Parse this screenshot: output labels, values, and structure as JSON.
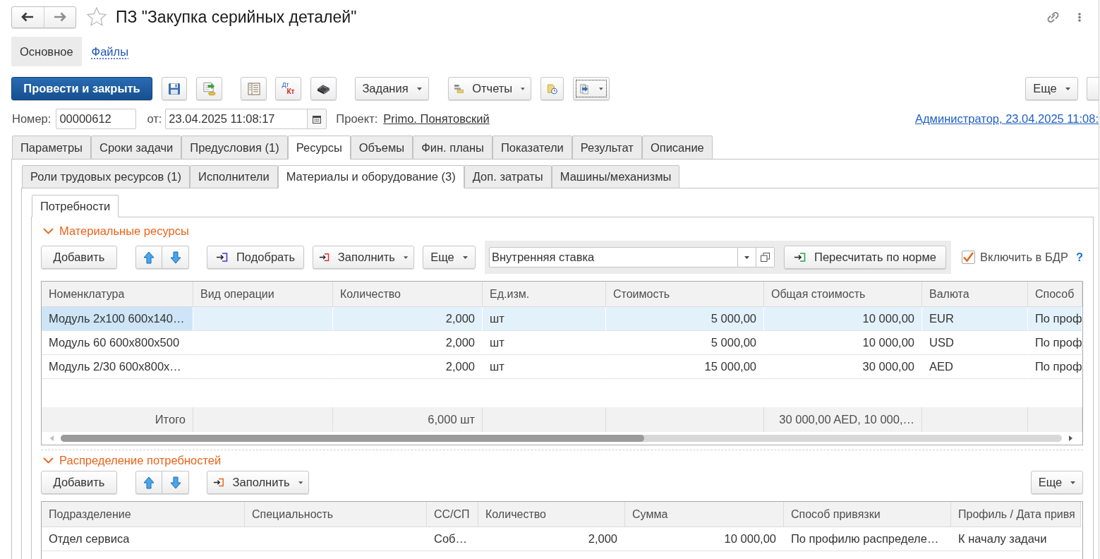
{
  "header": {
    "title": "ПЗ \"Закупка серийных деталей\"",
    "favorite": false
  },
  "sections": [
    {
      "label": "Основное",
      "selected": true
    },
    {
      "label": "Файлы",
      "selected": false
    }
  ],
  "toolbar": {
    "primary_button": "Провести и закрыть",
    "dt_kt_icon": {
      "top": "Дт",
      "bottom": "Кт"
    },
    "tasks_button": "Задания",
    "reports_button": "Отчеты",
    "transfer_button": {
      "focused": true
    },
    "more_button": "Еще"
  },
  "fields": {
    "number_label": "Номер:",
    "number": "00000612",
    "date_label": "от:",
    "date": "23.04.2025 11:08:17",
    "project_label": "Проект:",
    "project": "Primo. Понятовский",
    "author_link": "Администратор, 23.04.2025 11:08:"
  },
  "tabs": [
    {
      "label": "Параметры",
      "selected": false
    },
    {
      "label": "Сроки задачи",
      "selected": false
    },
    {
      "label": "Предусловия (1)",
      "selected": false
    },
    {
      "label": "Ресурсы",
      "selected": true
    },
    {
      "label": "Объемы",
      "selected": false
    },
    {
      "label": "Фин. планы",
      "selected": false
    },
    {
      "label": "Показатели",
      "selected": false
    },
    {
      "label": "Результат",
      "selected": false
    },
    {
      "label": "Описание",
      "selected": false
    }
  ],
  "resource_tabs": [
    {
      "label": "Роли трудовых ресурсов (1)",
      "selected": false
    },
    {
      "label": "Исполнители",
      "selected": false
    },
    {
      "label": "Материалы и оборудование (3)",
      "selected": true
    },
    {
      "label": "Доп. затраты",
      "selected": false
    },
    {
      "label": "Машины/механизмы",
      "selected": false
    }
  ],
  "material_tabs": [
    {
      "label": "Потребности",
      "selected": true
    }
  ],
  "materials": {
    "title": "Материальные ресурсы",
    "expanded": true,
    "toolbar": {
      "add_button": "Добавить",
      "pick_button": "Подобрать",
      "fill_button": "Заполнить",
      "more_button": "Еще",
      "rate": "Внутренняя ставка",
      "recalc_button": "Пересчитать по норме",
      "include_in_budget": {
        "label": "Включить в БДР",
        "checked": true
      },
      "help": "?"
    },
    "table": {
      "columns": [
        "Номенклатура",
        "Вид операции",
        "Количество",
        "Ед.изм.",
        "Стоимость",
        "Общая стоимость",
        "Валюта",
        "Способ"
      ],
      "rows": [
        {
          "nomenclature": "Модуль 2x100 600x140…",
          "quantity": "2,000",
          "unit": "шт",
          "cost": "5 000,00",
          "total": "10 000,00",
          "currency": "EUR",
          "column_8": "По проф",
          "selected": true
        },
        {
          "nomenclature": "Модуль 60 600x800x500",
          "quantity": "2,000",
          "unit": "шт",
          "cost": "5 000,00",
          "total": "10 000,00",
          "currency": "USD",
          "column_8": "По проф",
          "selected": false
        },
        {
          "nomenclature": "Модуль 2/30 600x800x…",
          "quantity": "2,000",
          "unit": "шт",
          "cost": "15 000,00",
          "total": "30 000,00",
          "currency": "AED",
          "column_8": "По проф",
          "selected": false
        }
      ],
      "footer": {
        "label": "Итого",
        "quantity": "6,000 шт",
        "total": "30 000,00 AED, 10 000,…"
      }
    }
  },
  "distribution": {
    "title": "Распределение потребностей",
    "expanded": true,
    "toolbar": {
      "add_button": "Добавить",
      "fill_button": "Заполнить",
      "more_button": "Еще"
    },
    "table": {
      "columns": [
        "Подразделение",
        "Специальность",
        "СС/СП",
        "Количество",
        "Сумма",
        "Способ привязки",
        "Профиль / Дата привя"
      ],
      "rows": [
        {
          "department": "Отдел сервиса",
          "cc_sp": "Соб…",
          "quantity": "2,000",
          "sum": "10 000,00",
          "binding": "По профилю распределе…",
          "column_7": "К началу задачи",
          "selected": false
        }
      ]
    }
  }
}
